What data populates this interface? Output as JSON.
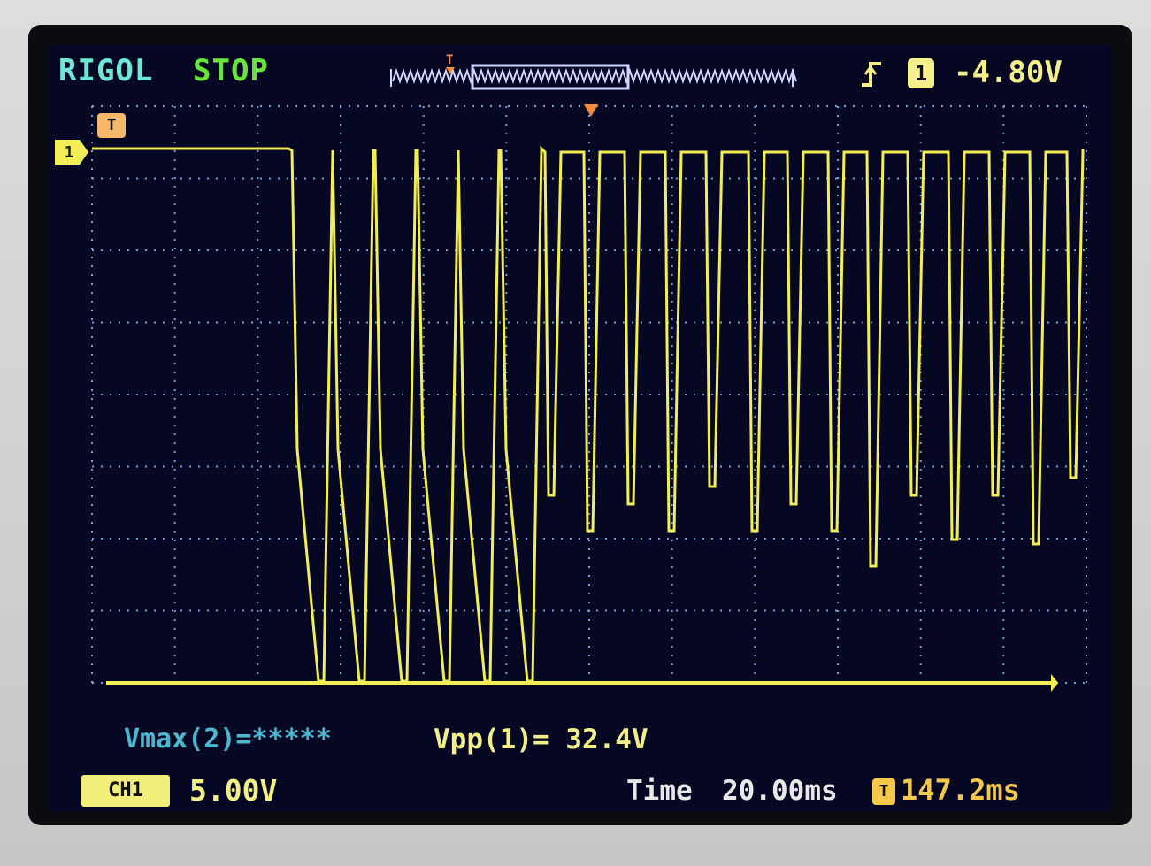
{
  "header": {
    "brand": "RIGOL",
    "run_status": "STOP",
    "trigger_source": "1",
    "trigger_level": "-4.80V"
  },
  "markers": {
    "trigger_marker_label": "T",
    "channel_marker_label": "1",
    "timeline_marker_label": "T"
  },
  "measurements": {
    "vmax_ch2": "Vmax(2)=*****",
    "vpp_ch1": "Vpp(1)= 32.4V"
  },
  "footer": {
    "channel_badge": "CH1",
    "channel_scale": "5.00V",
    "time_label": "Time",
    "time_base": "20.00ms",
    "trigger_position": "147.2ms"
  },
  "colors": {
    "trace": "#f2ee55",
    "grid": "#6fa2d6",
    "screen": "#060722"
  },
  "icons": {
    "trigger_edge": "rising-edge-icon",
    "trigger_position": "trigger-position-icon"
  }
}
